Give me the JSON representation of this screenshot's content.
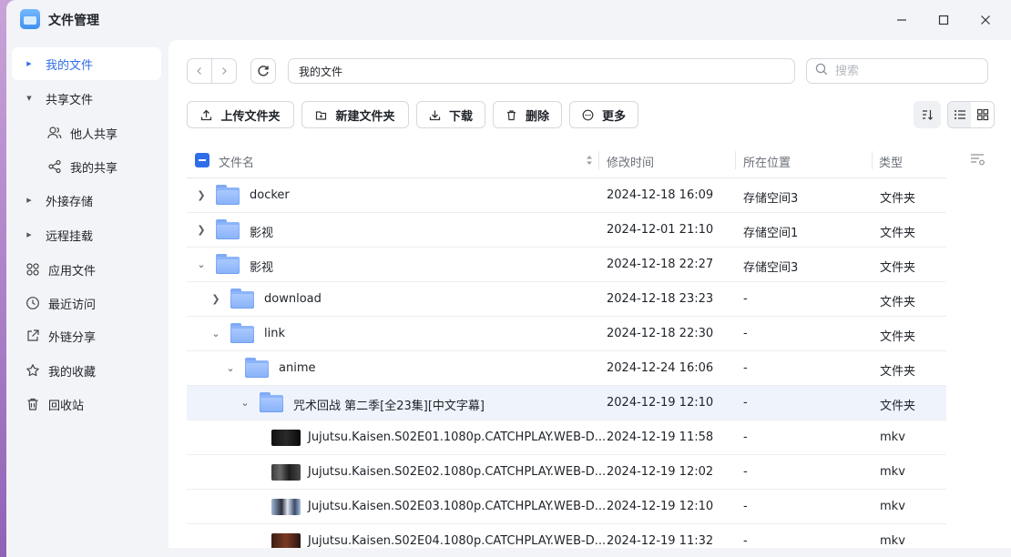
{
  "app": {
    "title": "文件管理"
  },
  "window_controls": {
    "minimize": "—",
    "maximize": "☐",
    "close": "✕"
  },
  "sidebar": {
    "items": [
      {
        "label": "我的文件",
        "icon": "caret-right-icon",
        "active": true
      },
      {
        "label": "共享文件",
        "icon": "caret-down-icon"
      },
      {
        "label": "他人共享",
        "icon": "users-icon"
      },
      {
        "label": "我的共享",
        "icon": "share-icon"
      },
      {
        "label": "外接存储",
        "icon": "caret-right-icon"
      },
      {
        "label": "远程挂载",
        "icon": "caret-right-icon"
      },
      {
        "label": "应用文件",
        "icon": "apps-icon"
      },
      {
        "label": "最近访问",
        "icon": "clock-icon"
      },
      {
        "label": "外链分享",
        "icon": "external-link-icon"
      },
      {
        "label": "我的收藏",
        "icon": "star-icon"
      },
      {
        "label": "回收站",
        "icon": "trash-icon"
      }
    ]
  },
  "toolbar": {
    "path": "我的文件",
    "search_placeholder": "搜索",
    "upload_label": "上传文件夹",
    "new_folder_label": "新建文件夹",
    "download_label": "下载",
    "delete_label": "删除",
    "more_label": "更多"
  },
  "table": {
    "headers": {
      "name": "文件名",
      "modified": "修改时间",
      "location": "所在位置",
      "type": "类型"
    },
    "rows": [
      {
        "name": "docker",
        "modified": "2024-12-18 16:09",
        "location": "存储空间3",
        "type": "文件夹",
        "kind": "folder",
        "expanded": false
      },
      {
        "name": "影视",
        "modified": "2024-12-01 21:10",
        "location": "存储空间1",
        "type": "文件夹",
        "kind": "folder",
        "expanded": false
      },
      {
        "name": "影视",
        "modified": "2024-12-18 22:27",
        "location": "存储空间3",
        "type": "文件夹",
        "kind": "folder",
        "expanded": true
      },
      {
        "name": "download",
        "modified": "2024-12-18 23:23",
        "location": "-",
        "type": "文件夹",
        "kind": "folder",
        "expanded": false
      },
      {
        "name": "link",
        "modified": "2024-12-18 22:30",
        "location": "-",
        "type": "文件夹",
        "kind": "folder",
        "expanded": true
      },
      {
        "name": "anime",
        "modified": "2024-12-24 16:06",
        "location": "-",
        "type": "文件夹",
        "kind": "folder",
        "expanded": true
      },
      {
        "name": "咒术回战 第二季[全23集][中文字幕]",
        "modified": "2024-12-19 12:10",
        "location": "-",
        "type": "文件夹",
        "kind": "folder",
        "expanded": true,
        "selected": true
      },
      {
        "name": "Jujutsu.Kaisen.S02E01.1080p.CATCHPLAY.WEB-D...",
        "modified": "2024-12-19 11:58",
        "location": "-",
        "type": "mkv",
        "kind": "video"
      },
      {
        "name": "Jujutsu.Kaisen.S02E02.1080p.CATCHPLAY.WEB-D...",
        "modified": "2024-12-19 12:02",
        "location": "-",
        "type": "mkv",
        "kind": "video"
      },
      {
        "name": "Jujutsu.Kaisen.S02E03.1080p.CATCHPLAY.WEB-D...",
        "modified": "2024-12-19 12:10",
        "location": "-",
        "type": "mkv",
        "kind": "video"
      },
      {
        "name": "Jujutsu.Kaisen.S02E04.1080p.CATCHPLAY.WEB-D...",
        "modified": "2024-12-19 11:32",
        "location": "-",
        "type": "mkv",
        "kind": "video"
      }
    ]
  },
  "colors": {
    "accent": "#2f6ee8",
    "folder": "#8ab3f9",
    "selected_row": "#eef3fc"
  }
}
